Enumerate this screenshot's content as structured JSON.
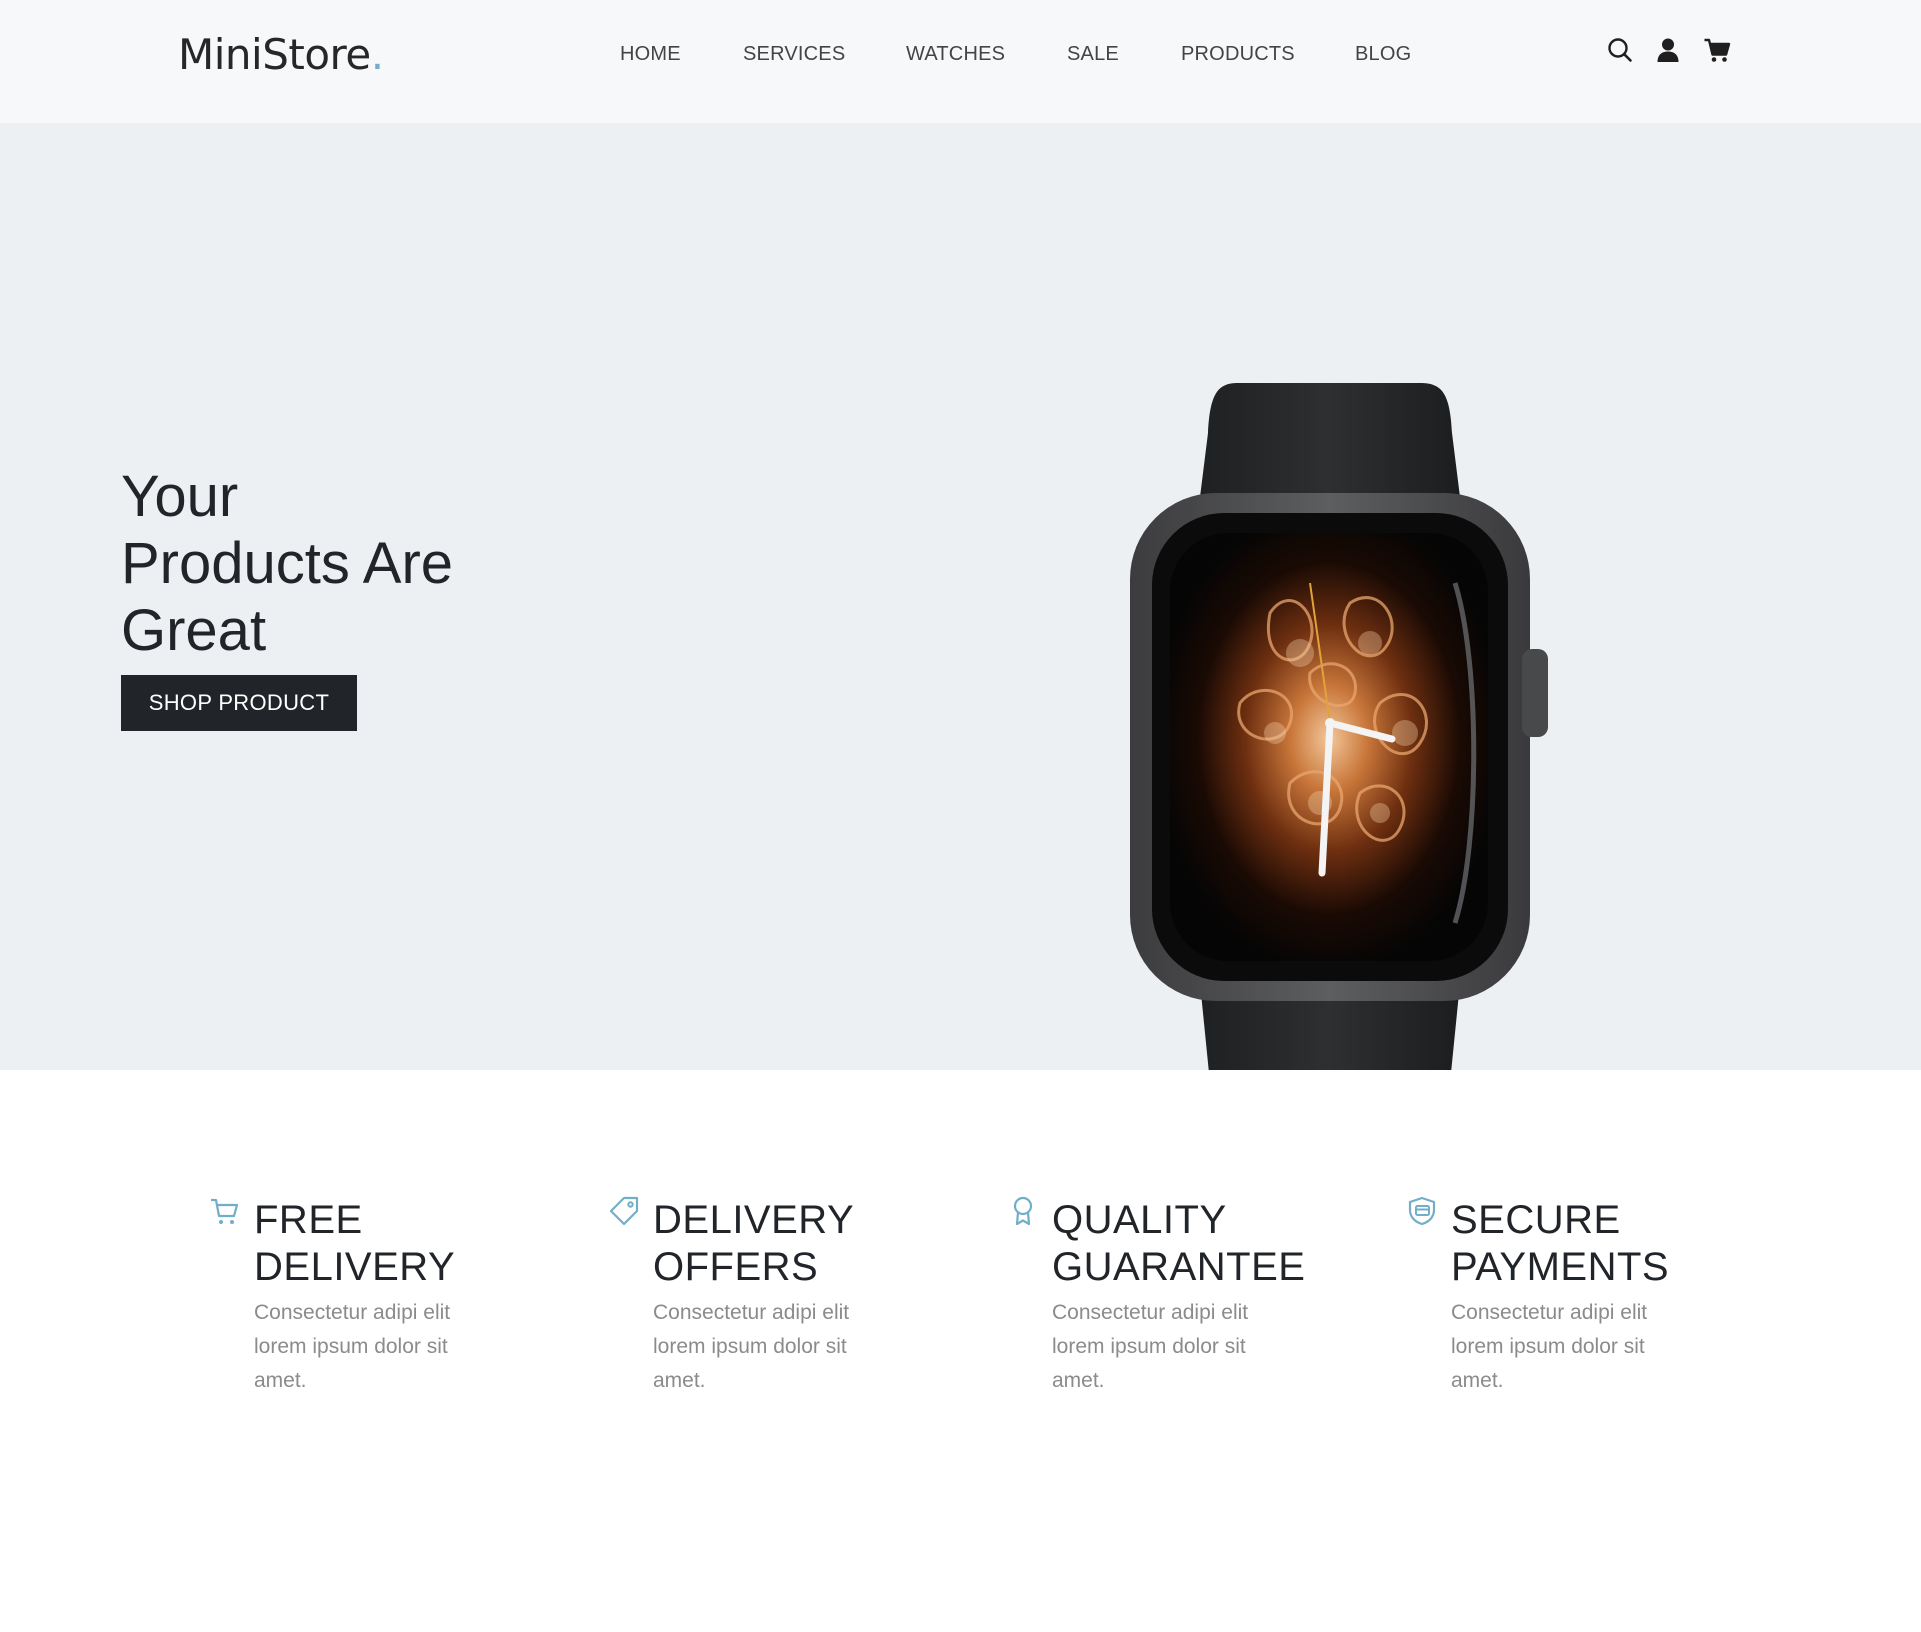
{
  "brand": {
    "logo_text": "MiniStore",
    "logo_dot": ".",
    "accent_color": "#72aec8"
  },
  "nav": {
    "items": [
      {
        "label": "HOME"
      },
      {
        "label": "SERVICES"
      },
      {
        "label": "WATCHES"
      },
      {
        "label": "SALE"
      },
      {
        "label": "PRODUCTS"
      },
      {
        "label": "BLOG"
      }
    ],
    "icons": [
      "search-icon",
      "user-icon",
      "cart-icon"
    ]
  },
  "hero": {
    "title_lines": [
      "Your",
      "Products Are",
      "Great"
    ],
    "button_label": "SHOP PRODUCT",
    "image": "smartwatch-photo",
    "background_color": "#edf0f3"
  },
  "features": [
    {
      "icon": "cart-icon",
      "title_lines": [
        "FREE",
        "DELIVERY"
      ],
      "text": "Consectetur adipi elit lorem ipsum dolor sit amet."
    },
    {
      "icon": "price-tag-icon",
      "title_lines": [
        "DELIVERY",
        "OFFERS"
      ],
      "text": "Consectetur adipi elit lorem ipsum dolor sit amet."
    },
    {
      "icon": "award-badge-icon",
      "title_lines": [
        "QUALITY",
        "GUARANTEE"
      ],
      "text": "Consectetur adipi elit lorem ipsum dolor sit amet."
    },
    {
      "icon": "secure-payment-icon",
      "title_lines": [
        "SECURE",
        "PAYMENTS"
      ],
      "text": "Consectetur adipi elit lorem ipsum dolor sit amet."
    }
  ]
}
